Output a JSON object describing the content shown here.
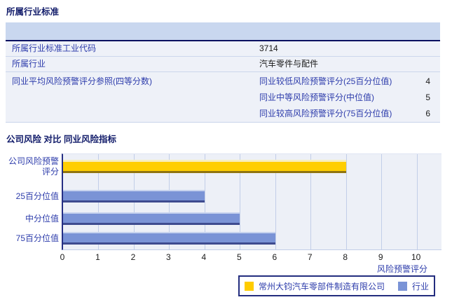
{
  "industry_section": {
    "title": "所属行业标准",
    "rows": [
      {
        "label": "所属行业标准工业代码",
        "value": "3714"
      },
      {
        "label": "所属行业",
        "value": "汽车零件与配件"
      }
    ],
    "peer_reference": {
      "label": "同业平均风险预警评分参照(四等分数)",
      "items": [
        {
          "label": "同业较低风险预警评分(25百分位值)",
          "value": "4"
        },
        {
          "label": "同业中等风险预警评分(中位值)",
          "value": "5"
        },
        {
          "label": "同业较高风险预警评分(75百分位值)",
          "value": "6"
        }
      ]
    }
  },
  "comparison_section": {
    "title": "公司风险 对比 同业风险指标"
  },
  "chart_data": {
    "type": "bar",
    "orientation": "horizontal",
    "title": "公司风险 对比 同业风险指标",
    "categories": [
      "公司风险预警评分",
      "25百分位值",
      "中分位值",
      "75百分位值"
    ],
    "values": [
      8,
      4,
      5,
      6
    ],
    "bar_colors": [
      "#FFCC00",
      "#7A93D6",
      "#7A93D6",
      "#7A93D6"
    ],
    "xlabel": "风险预警评分",
    "xticks": [
      0,
      1,
      2,
      3,
      4,
      5,
      6,
      7,
      8,
      9,
      10
    ],
    "xlim": [
      0,
      10.7
    ],
    "grid": true,
    "legend_position": "bottom",
    "legend": [
      {
        "label": "常州大钧汽车零部件制造有限公司",
        "color": "#FFCC00"
      },
      {
        "label": "行业",
        "color": "#7A93D6"
      }
    ],
    "colors": {
      "plot_background": "#EDF0F7",
      "gridline": "#C2CEE8",
      "axis": "#252F84",
      "label_text": "#2D3CAB"
    }
  }
}
